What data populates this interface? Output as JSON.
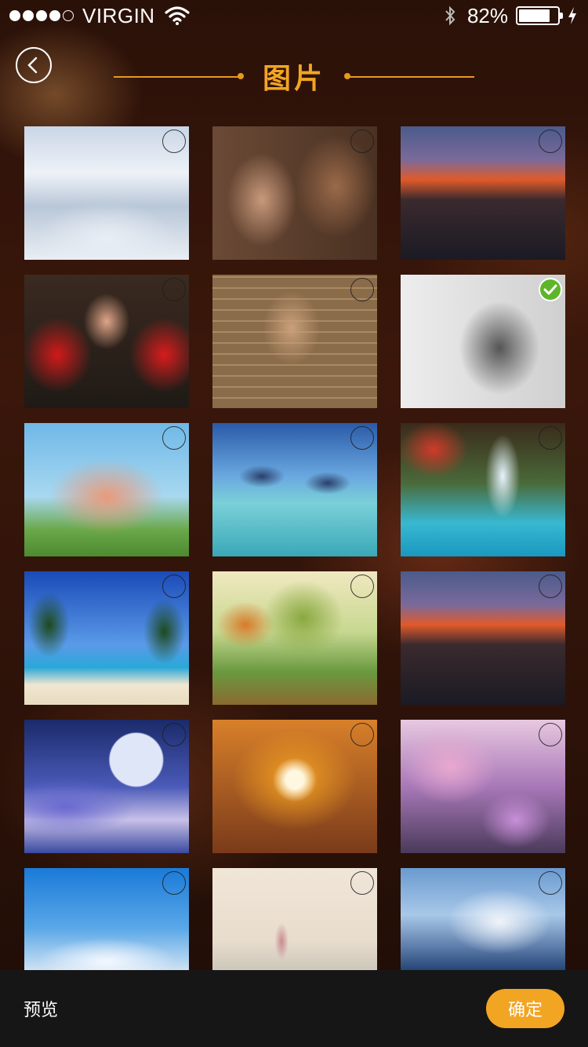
{
  "status_bar": {
    "carrier": "VIRGIN",
    "signal_bars": 4,
    "signal_total": 5,
    "battery_percent": "82%",
    "battery_level": 0.82,
    "icons": [
      "wifi-icon",
      "bluetooth-icon",
      "battery-icon",
      "charging-icon"
    ]
  },
  "header": {
    "title": "图片",
    "back_icon": "chevron-left-icon"
  },
  "colors": {
    "accent": "#f2a523",
    "selected": "#5fb52a",
    "bottom_bar": "#161616"
  },
  "photos": [
    {
      "subject": "snowy-castle",
      "selected": false
    },
    {
      "subject": "couple-kissing",
      "selected": false
    },
    {
      "subject": "city-sunset",
      "selected": false
    },
    {
      "subject": "girl-with-red-flags",
      "selected": false
    },
    {
      "subject": "man-against-brick-wall",
      "selected": false
    },
    {
      "subject": "man-portrait-sketch",
      "selected": true
    },
    {
      "subject": "happy-family",
      "selected": false
    },
    {
      "subject": "dolphins",
      "selected": false
    },
    {
      "subject": "waterfall",
      "selected": false
    },
    {
      "subject": "palm-beach",
      "selected": false
    },
    {
      "subject": "autumn-tree-painting",
      "selected": false
    },
    {
      "subject": "city-sunset",
      "selected": false
    },
    {
      "subject": "moon-and-planets",
      "selected": false
    },
    {
      "subject": "maple-leaf-sun",
      "selected": false
    },
    {
      "subject": "cherry-blossom-street",
      "selected": false
    },
    {
      "subject": "snowy-trees",
      "selected": false
    },
    {
      "subject": "girl-on-beach",
      "selected": false
    },
    {
      "subject": "snowy-mountain-lake",
      "selected": false
    }
  ],
  "bottom_bar": {
    "preview_label": "预览",
    "confirm_label": "确定"
  }
}
